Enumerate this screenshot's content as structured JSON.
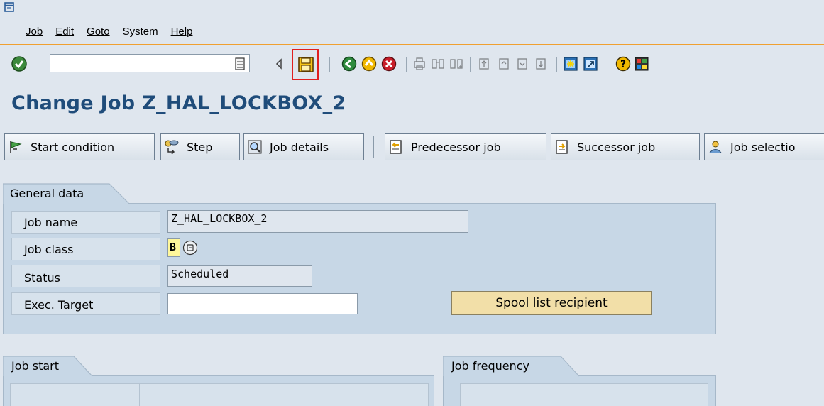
{
  "menu": {
    "items": [
      {
        "label": "Job"
      },
      {
        "label": "Edit"
      },
      {
        "label": "Goto"
      },
      {
        "label": "System"
      },
      {
        "label": "Help"
      }
    ]
  },
  "command_field": {
    "value": ""
  },
  "page_title": "Change Job Z_HAL_LOCKBOX_2",
  "app_toolbar": {
    "start_condition": "Start condition",
    "step": "Step",
    "job_details": "Job details",
    "predecessor_job": "Predecessor job",
    "successor_job": "Successor job",
    "job_selection": "Job selectio"
  },
  "general_data": {
    "tab": "General data",
    "job_name_label": "Job name",
    "job_name_value": "Z_HAL_LOCKBOX_2",
    "job_class_label": "Job class",
    "job_class_value": "B",
    "status_label": "Status",
    "status_value": "Scheduled",
    "exec_target_label": "Exec. Target",
    "exec_target_value": "",
    "spool_button": "Spool list recipient"
  },
  "job_start": {
    "tab": "Job start"
  },
  "job_frequency": {
    "tab": "Job frequency"
  },
  "colors": {
    "title": "#1f4c7a",
    "highlight": "#e02020",
    "accent_line": "#f0a030"
  }
}
